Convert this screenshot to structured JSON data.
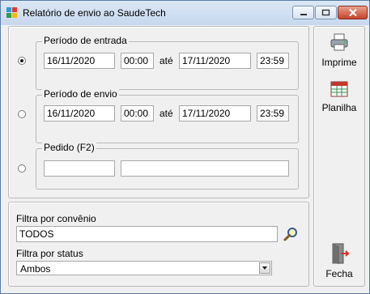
{
  "window": {
    "title": "Relatório de envio ao SaudeTech",
    "controls": [
      "minimize",
      "maximize",
      "close"
    ]
  },
  "periodo_entrada": {
    "legend": "Período de entrada",
    "selected": true,
    "date_from": "16/11/2020",
    "time_from": "00:00",
    "ate": "até",
    "date_to": "17/11/2020",
    "time_to": "23:59"
  },
  "periodo_envio": {
    "legend": "Período de envio",
    "selected": false,
    "date_from": "16/11/2020",
    "time_from": "00:00",
    "ate": "até",
    "date_to": "17/11/2020",
    "time_to": "23:59"
  },
  "pedido": {
    "legend": "Pedido (F2)",
    "selected": false,
    "code": "",
    "name": ""
  },
  "filtros": {
    "convenio_label": "Filtra por convênio",
    "convenio_value": "TODOS",
    "status_label": "Filtra por status",
    "status_value": "Ambos"
  },
  "sidebar": {
    "imprime": "Imprime",
    "planilha": "Planilha",
    "fecha": "Fecha"
  },
  "colors": {
    "window_bg": "#f0f0f0",
    "title_bar": "#c7d8ee",
    "close_button": "#c7432b"
  },
  "icons": [
    "app-logo-icon",
    "printer-icon",
    "spreadsheet-icon",
    "magnifier-icon",
    "exit-door-icon"
  ]
}
